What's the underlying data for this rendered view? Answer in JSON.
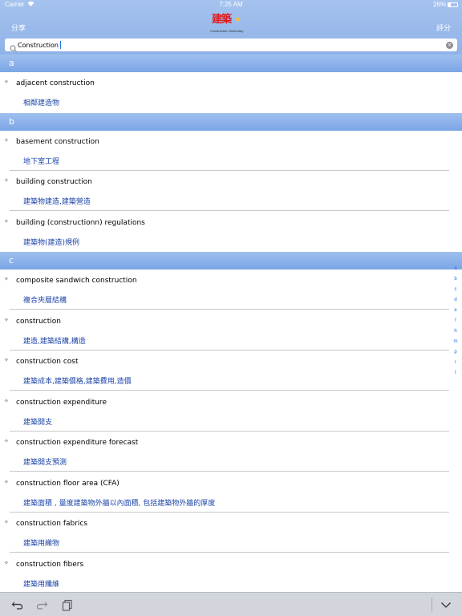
{
  "status": {
    "carrier": "Carrier",
    "time": "7:25 AM",
    "battery": "26%"
  },
  "header": {
    "share_label": "分享",
    "rate_label": "評分",
    "logo_title": "建築",
    "logo_subtitle": "Construction Dictionary"
  },
  "search": {
    "value": "Construction",
    "placeholder": ""
  },
  "sections": [
    {
      "letter": "a",
      "items": [
        {
          "term": "adjacent construction",
          "definition": "相鄰建造物"
        }
      ]
    },
    {
      "letter": "b",
      "items": [
        {
          "term": "basement construction",
          "definition": "地下室工程"
        },
        {
          "term": "building construction",
          "definition": "建築物建造,建築營造"
        },
        {
          "term": "building (constructionn) regulations",
          "definition": "建築物(建造)規例"
        }
      ]
    },
    {
      "letter": "c",
      "items": [
        {
          "term": "composite sandwich construction",
          "definition": "複合夾層結構"
        },
        {
          "term": "construction",
          "definition": "建造,建築結構,構造"
        },
        {
          "term": "construction cost",
          "definition": "建築成本,建築價格,建築費用,造價"
        },
        {
          "term": "construction expenditure",
          "definition": "建築開支"
        },
        {
          "term": "construction expenditure forecast",
          "definition": "建築開支預測"
        },
        {
          "term": "construction floor area (CFA)",
          "definition": "建築面積 , 量度建築物外牆以內面積, 包括建築物外牆的厚度"
        },
        {
          "term": "construction fabrics",
          "definition": "建築用織物"
        },
        {
          "term": "construction fibers",
          "definition": "建築用纖維"
        }
      ]
    }
  ],
  "index_letters": [
    "a",
    "b",
    "c",
    "d",
    "e",
    "f",
    "h",
    "m",
    "p",
    "r",
    "t"
  ],
  "colors": {
    "header": "#93b4e9",
    "section": "#86abe8",
    "definition": "#1d45a8"
  },
  "toolbar": {
    "undo_icon": "undo-icon",
    "redo_icon": "redo-icon",
    "clipboard_icon": "clipboard-icon",
    "keyboard_dismiss_icon": "chevron-down-icon"
  }
}
